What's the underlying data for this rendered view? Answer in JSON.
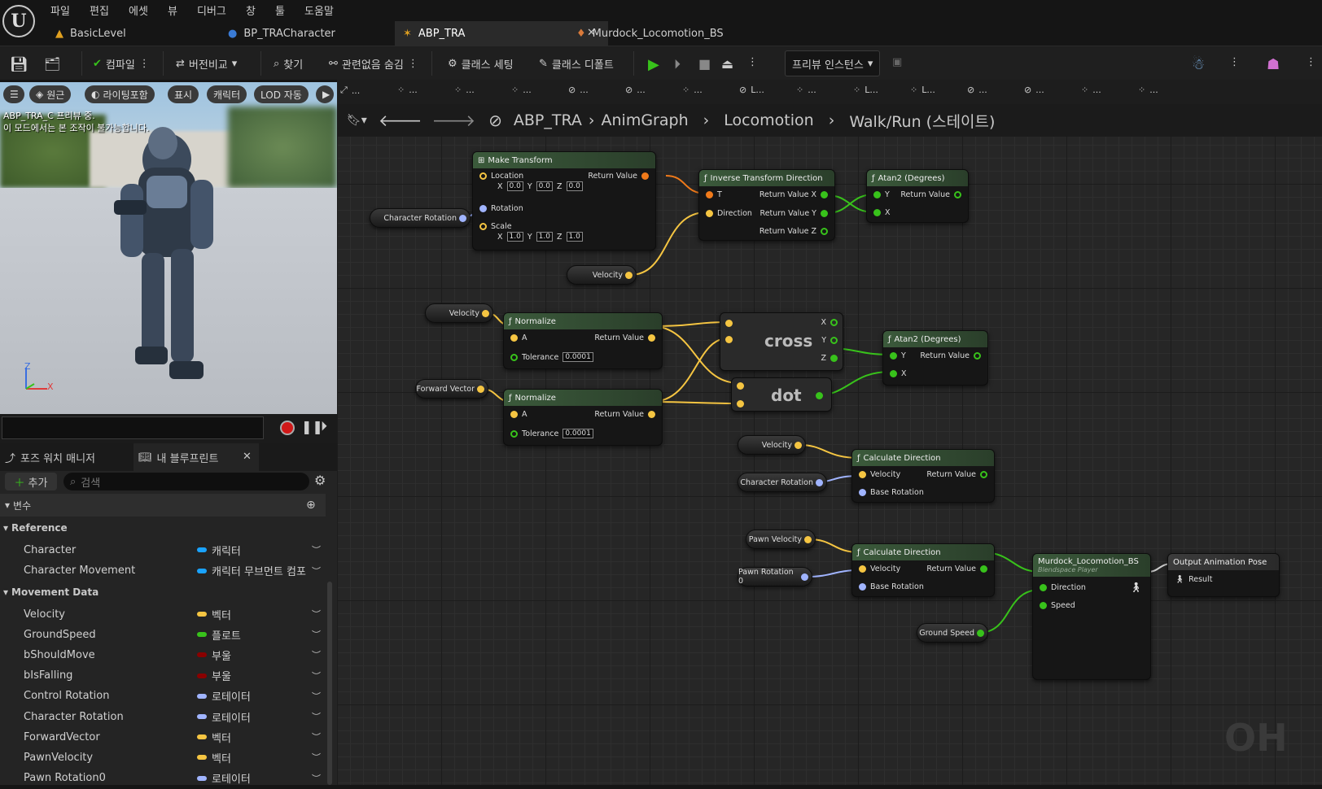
{
  "menu": [
    "파일",
    "편집",
    "에셋",
    "뷰",
    "디버그",
    "창",
    "툴",
    "도움말"
  ],
  "tabs": [
    {
      "label": "BasicLevel"
    },
    {
      "label": "BP_TRACharacter"
    },
    {
      "label": "ABP_TRA"
    },
    {
      "label": "Murdock_Locomotion_BS"
    }
  ],
  "toolbar": {
    "compile": "컴파일",
    "diff": "버전비교",
    "find": "찾기",
    "hide": "관련없음 숨김",
    "class_settings": "클래스 세팅",
    "class_defaults": "클래스 디폴트",
    "preview": "프리뷰 인스턴스"
  },
  "viewport": {
    "chips": [
      "원근",
      "라이팅포함",
      "표시",
      "캐릭터",
      "LOD 자동"
    ],
    "line1": "ABP_TRA_C 프리뷰 중.",
    "line2": "이 모드에서는 본 조작이 불가능합니다.",
    "axis_z": "Z",
    "axis_x": "X"
  },
  "panel": {
    "tab1": "포즈 워치 매니저",
    "tab2": "내 블루프린트",
    "add": "추가",
    "search_placeholder": "검색",
    "vars_header": "변수",
    "cat1": "Reference",
    "cat2": "Movement Data",
    "vars": [
      {
        "name": "Character",
        "type": "캐릭터",
        "color": "#1aa3ff"
      },
      {
        "name": "Character Movement",
        "type": "캐릭터 무브먼트 컴포",
        "color": "#1aa3ff"
      },
      {
        "name": "Velocity",
        "type": "벡터",
        "color": "#f5c542"
      },
      {
        "name": "GroundSpeed",
        "type": "플로트",
        "color": "#38c21b"
      },
      {
        "name": "bShouldMove",
        "type": "부울",
        "color": "#8a0000"
      },
      {
        "name": "bIsFalling",
        "type": "부울",
        "color": "#8a0000"
      },
      {
        "name": "Control Rotation",
        "type": "로테이터",
        "color": "#a0b4ff"
      },
      {
        "name": "Character Rotation",
        "type": "로테이터",
        "color": "#a0b4ff"
      },
      {
        "name": "ForwardVector",
        "type": "벡터",
        "color": "#f5c542"
      },
      {
        "name": "PawnVelocity",
        "type": "벡터",
        "color": "#f5c542"
      },
      {
        "name": "Pawn Rotation0",
        "type": "로테이터",
        "color": "#a0b4ff"
      }
    ]
  },
  "breadcrumb": [
    "ABP_TRA",
    "AnimGraph",
    "Locomotion",
    "Walk/Run (스테이트)"
  ],
  "graph_toolbar": [
    "...",
    "...",
    "...",
    "...",
    "...",
    "...",
    "...",
    "L...",
    "...",
    "L...",
    "L...",
    "...",
    "...",
    "...",
    "..."
  ],
  "nodes": {
    "make_transform": {
      "title": "Make Transform",
      "location": "Location",
      "rotation": "Rotation",
      "scale": "Scale",
      "ret": "Return Value",
      "x": "X",
      "y": "Y",
      "z": "Z",
      "lx": "0.0",
      "ly": "0.0",
      "lz": "0.0",
      "sx": "1.0",
      "sy": "1.0",
      "sz": "1.0"
    },
    "inv_transform": {
      "title": "Inverse Transform Direction",
      "t": "T",
      "dir": "Direction",
      "rx": "Return Value X",
      "ry": "Return Value Y",
      "rz": "Return Value Z"
    },
    "atan1": {
      "title": "Atan2 (Degrees)",
      "y": "Y",
      "x": "X",
      "ret": "Return Value"
    },
    "atan2": {
      "title": "Atan2 (Degrees)",
      "y": "Y",
      "x": "X",
      "ret": "Return Value"
    },
    "norm1": {
      "title": "Normalize",
      "a": "A",
      "tol": "Tolerance",
      "tolv": "0.0001",
      "ret": "Return Value"
    },
    "norm2": {
      "title": "Normalize",
      "a": "A",
      "tol": "Tolerance",
      "tolv": "0.0001",
      "ret": "Return Value"
    },
    "cross": {
      "label": "cross",
      "x": "X",
      "y": "Y",
      "z": "Z"
    },
    "dot": {
      "label": "dot"
    },
    "calc1": {
      "title": "Calculate Direction",
      "vel": "Velocity",
      "base": "Base Rotation",
      "ret": "Return Value"
    },
    "calc2": {
      "title": "Calculate Direction",
      "vel": "Velocity",
      "base": "Base Rotation",
      "ret": "Return Value"
    },
    "bs": {
      "title": "Murdock_Locomotion_BS",
      "subtitle": "Blendspace Player",
      "dir": "Direction",
      "speed": "Speed"
    },
    "output": {
      "title": "Output Animation Pose",
      "result": "Result"
    },
    "getters": {
      "char_rot1": "Character Rotation",
      "velocity1": "Velocity",
      "velocity2": "Velocity",
      "forward": "Forward Vector",
      "velocity3": "Velocity",
      "char_rot2": "Character Rotation",
      "pawn_vel": "Pawn Velocity",
      "pawn_rot": "Pawn Rotation 0",
      "ground_speed": "Ground Speed"
    }
  },
  "watermark": "OH",
  "colors": {
    "vector": "#f5c542",
    "float": "#38c21b",
    "rotator": "#a0b4ff",
    "transform": "#f07a1a",
    "node_header": "#3b5a3b"
  }
}
